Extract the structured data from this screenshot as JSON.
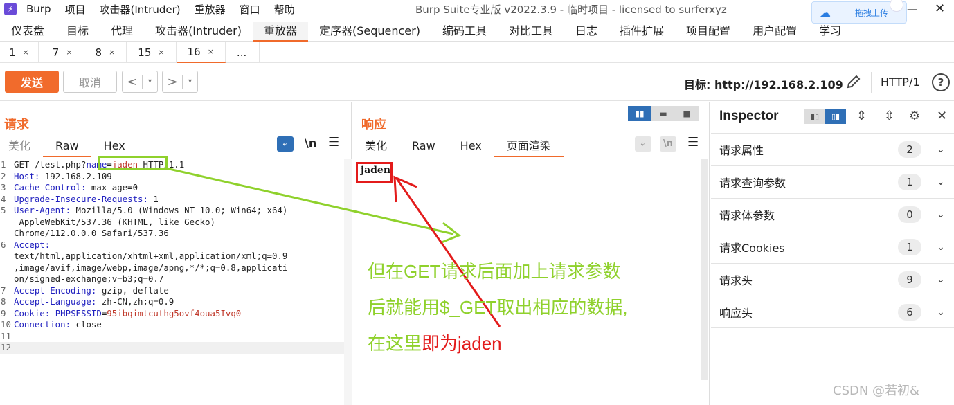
{
  "titlebar": {
    "app_name": "Burp",
    "menus": [
      "项目",
      "攻击器(Intruder)",
      "重放器",
      "窗口",
      "帮助"
    ],
    "window_title": "Burp Suite专业版  v2022.3.9 - 临时项目 - licensed to surferxyz",
    "upload_label": "拖拽上传",
    "minimize_glyph": "—",
    "close_glyph": "✕"
  },
  "main_tabs": [
    "仪表盘",
    "目标",
    "代理",
    "攻击器(Intruder)",
    "重放器",
    "定序器(Sequencer)",
    "编码工具",
    "对比工具",
    "日志",
    "插件扩展",
    "项目配置",
    "用户配置",
    "学习"
  ],
  "active_main_tab": "重放器",
  "sub_tabs": [
    {
      "label": "1",
      "close": "×"
    },
    {
      "label": "7",
      "close": "×"
    },
    {
      "label": "8",
      "close": "×"
    },
    {
      "label": "15",
      "close": "×"
    },
    {
      "label": "16",
      "close": "×"
    },
    {
      "label": "...",
      "close": ""
    }
  ],
  "toolbar": {
    "send_label": "发送",
    "cancel_label": "取消",
    "back_glyph": "<",
    "forward_glyph": ">",
    "dropdown_glyph": "▾",
    "target_label": "目标: http://192.168.2.109",
    "http_version": "HTTP/1",
    "help_glyph": "?"
  },
  "request": {
    "title": "请求",
    "tabs": [
      "美化",
      "Raw",
      "Hex"
    ],
    "active_tab": "Raw",
    "newline_glyph": "\\n",
    "lines": [
      {
        "n": "1",
        "parts": [
          [
            "code",
            "GET /test.php?"
          ],
          [
            "param",
            "name"
          ],
          [
            "code",
            "="
          ],
          [
            "param-val",
            "jaden"
          ],
          [
            "code",
            " HTTP/1.1"
          ]
        ]
      },
      {
        "n": "2",
        "parts": [
          [
            "key",
            "Host:"
          ],
          [
            "code",
            " 192.168.2.109"
          ]
        ]
      },
      {
        "n": "3",
        "parts": [
          [
            "key",
            "Cache-Control:"
          ],
          [
            "code",
            " max-age=0"
          ]
        ]
      },
      {
        "n": "4",
        "parts": [
          [
            "key",
            "Upgrade-Insecure-Requests:"
          ],
          [
            "code",
            " 1"
          ]
        ]
      },
      {
        "n": "5",
        "parts": [
          [
            "key",
            "User-Agent:"
          ],
          [
            "code",
            " Mozilla/5.0 (Windows NT 10.0; Win64; x64)"
          ]
        ]
      },
      {
        "n": "",
        "parts": [
          [
            "code",
            " AppleWebKit/537.36 (KHTML, like Gecko)"
          ]
        ]
      },
      {
        "n": "",
        "parts": [
          [
            "code",
            "Chrome/112.0.0.0 Safari/537.36"
          ]
        ]
      },
      {
        "n": "6",
        "parts": [
          [
            "key",
            "Accept:"
          ]
        ]
      },
      {
        "n": "",
        "parts": [
          [
            "code",
            "text/html,application/xhtml+xml,application/xml;q=0.9"
          ]
        ]
      },
      {
        "n": "",
        "parts": [
          [
            "code",
            ",image/avif,image/webp,image/apng,*/*;q=0.8,applicati"
          ]
        ]
      },
      {
        "n": "",
        "parts": [
          [
            "code",
            "on/signed-exchange;v=b3;q=0.7"
          ]
        ]
      },
      {
        "n": "7",
        "parts": [
          [
            "key",
            "Accept-Encoding:"
          ],
          [
            "code",
            " gzip, deflate"
          ]
        ]
      },
      {
        "n": "8",
        "parts": [
          [
            "key",
            "Accept-Language:"
          ],
          [
            "code",
            " zh-CN,zh;q=0.9"
          ]
        ]
      },
      {
        "n": "9",
        "parts": [
          [
            "key",
            "Cookie:"
          ],
          [
            "code",
            " "
          ],
          [
            "key",
            "PHPSESSID"
          ],
          [
            "code",
            "="
          ],
          [
            "cookie-val",
            "95ibqimtcuthg5ovf4oua5Ivq0"
          ]
        ]
      },
      {
        "n": "10",
        "parts": [
          [
            "key",
            "Connection:"
          ],
          [
            "code",
            " close"
          ]
        ]
      },
      {
        "n": "11",
        "parts": []
      },
      {
        "n": "12",
        "parts": []
      }
    ]
  },
  "response": {
    "title": "响应",
    "tabs": [
      "美化",
      "Raw",
      "Hex",
      "页面渲染"
    ],
    "active_tab": "页面渲染",
    "newline_glyph": "\\n",
    "rendered_text": "jaden"
  },
  "inspector": {
    "title": "Inspector",
    "sections": [
      {
        "label": "请求属性",
        "count": "2"
      },
      {
        "label": "请求查询参数",
        "count": "1"
      },
      {
        "label": "请求体参数",
        "count": "0"
      },
      {
        "label": "请求Cookies",
        "count": "1"
      },
      {
        "label": "请求头",
        "count": "9"
      },
      {
        "label": "响应头",
        "count": "6"
      }
    ]
  },
  "annotation": {
    "line1": "但在GET请求后面加上请求参数",
    "line2": "后就能用$_GET取出相应的数据,",
    "line3_prefix": "在这里",
    "line3_highlight": "即为jaden"
  },
  "watermark": "CSDN @若初&",
  "colors": {
    "accent": "#f06a2b",
    "blue": "#2f6fb6",
    "annotation_green": "#8fd12c",
    "annotation_red": "#e31b1b"
  }
}
